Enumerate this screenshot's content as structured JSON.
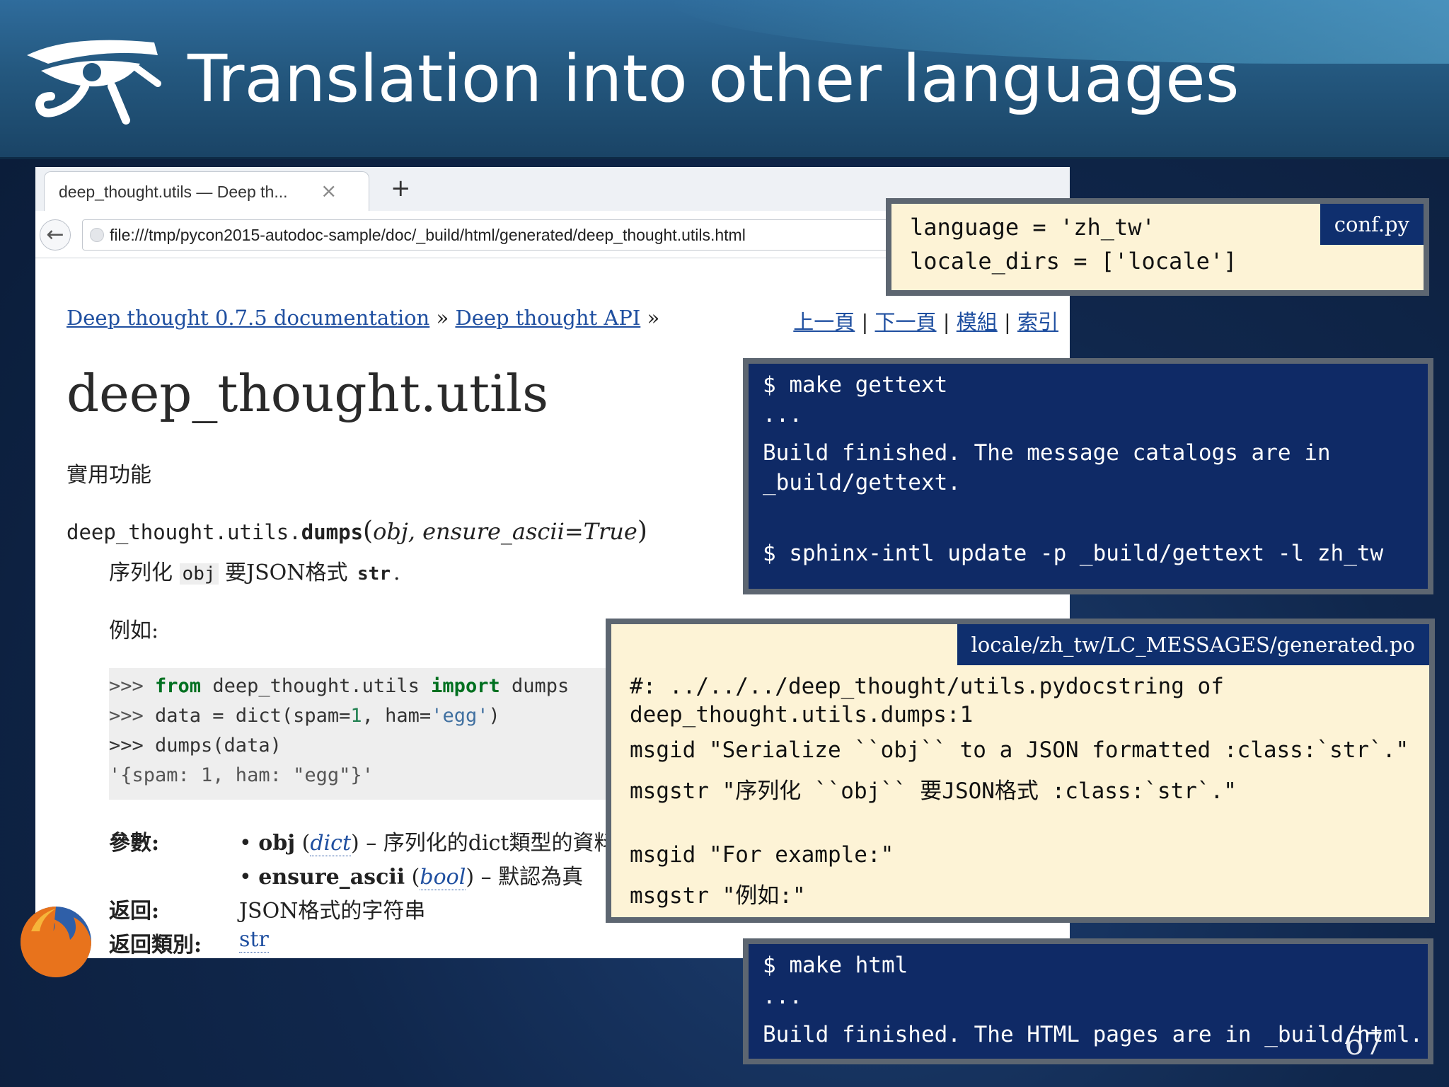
{
  "slide": {
    "title": "Translation into other languages",
    "number": "67"
  },
  "browser": {
    "tab_title": "deep_thought.utils — Deep th...",
    "tab_close": "×",
    "new_tab": "+",
    "back": "←",
    "url": "file:///tmp/pycon2015-autodoc-sample/doc/_build/html/generated/deep_thought.utils.html"
  },
  "page": {
    "breadcrumb": {
      "item1": "Deep thought 0.7.5 documentation",
      "sep1": " » ",
      "item2": "Deep thought API",
      "sep2": " »"
    },
    "relnav": {
      "prev": "上一頁",
      "next": "下一頁",
      "modules": "模組",
      "index": "索引",
      "sep": " | "
    },
    "module_title": "deep_thought.utils",
    "module_desc": "實用功能",
    "func": {
      "prefix": "deep_thought.utils.",
      "name": "dumps",
      "open": "(",
      "params": "obj, ensure_ascii=True",
      "close": ")"
    },
    "func_desc": {
      "p1": "序列化 ",
      "code1": "obj",
      "p2": " 要JSON格式 ",
      "code2": "str",
      "p3": "."
    },
    "example_label": "例如:",
    "code": {
      "l1_prompt": ">>> ",
      "l1_from": "from",
      "l1_mod": " deep_thought.utils ",
      "l1_import": "import",
      "l1_name": " dumps",
      "l2_prompt": ">>> ",
      "l2_a": "data = dict(spam=",
      "l2_num": "1",
      "l2_b": ", ham=",
      "l2_str": "'egg'",
      "l2_c": ")",
      "l3": ">>> dumps(data)",
      "l4": "'{spam: 1, ham: \"egg\"}'"
    },
    "fields": {
      "params_label": "參數:",
      "param1_name": "obj",
      "param1_type": "dict",
      "param1_desc": " – 序列化的dict類型的資料",
      "param2_name": "ensure_ascii",
      "param2_type": "bool",
      "param2_desc": " – 默認為真",
      "returns_label": "返回:",
      "returns_value": "JSON格式的字符串",
      "rtype_label": "返回類別:",
      "rtype_value": "str",
      "bullet": "•"
    }
  },
  "conf_box": {
    "tag": "conf.py",
    "line1": "language = 'zh_tw'",
    "line2": "locale_dirs = ['locale']"
  },
  "gettext_box": {
    "line1": "$ make gettext",
    "line2": "...",
    "line3": "Build finished. The message catalogs are in",
    "line4": "_build/gettext.",
    "line5": "$ sphinx-intl update -p _build/gettext -l zh_tw"
  },
  "po_box": {
    "tag": "locale/zh_tw/LC_MESSAGES/generated.po",
    "line1": "#: ../../../deep_thought/utils.pydocstring of",
    "line2": "deep_thought.utils.dumps:1",
    "line3": "msgid \"Serialize ``obj`` to a JSON formatted :class:`str`.\"",
    "line4": "msgstr \"序列化 ``obj`` 要JSON格式 :class:`str`.\"",
    "line5": "msgid \"For example:\"",
    "line6": "msgstr \"例如:\""
  },
  "html_box": {
    "line1": "$ make html",
    "line2": "...",
    "line3": "Build finished. The HTML pages are in _build/html."
  },
  "colors": {
    "header": "#24587f",
    "terminal_bg": "#0f2a66",
    "file_bg": "#fdf3d6",
    "link": "#1f4fa0"
  }
}
